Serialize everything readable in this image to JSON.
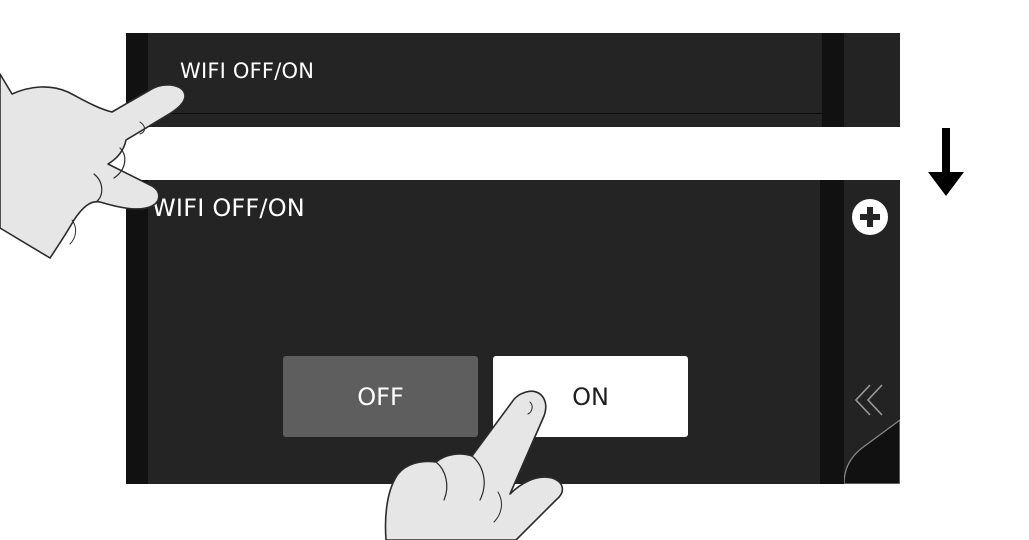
{
  "collapsed_row": {
    "title": "WIFI OFF/ON"
  },
  "expanded_panel": {
    "title": "WIFI OFF/ON",
    "buttons": {
      "off_label": "OFF",
      "on_label": "ON"
    },
    "selected": "ON"
  },
  "icons": {
    "add": "plus-circle-icon",
    "collapse": "double-chevron-left-icon",
    "transition": "down-arrow-icon",
    "gesture_top": "pointing-hand-icon",
    "gesture_bottom": "tapping-hand-icon"
  },
  "colors": {
    "panel_background": "#242424",
    "panel_edge": "#111111",
    "off_button": "#5e5e5e",
    "on_button": "#ffffff",
    "text_light": "#ffffff",
    "text_dark": "#1f1f1f"
  }
}
